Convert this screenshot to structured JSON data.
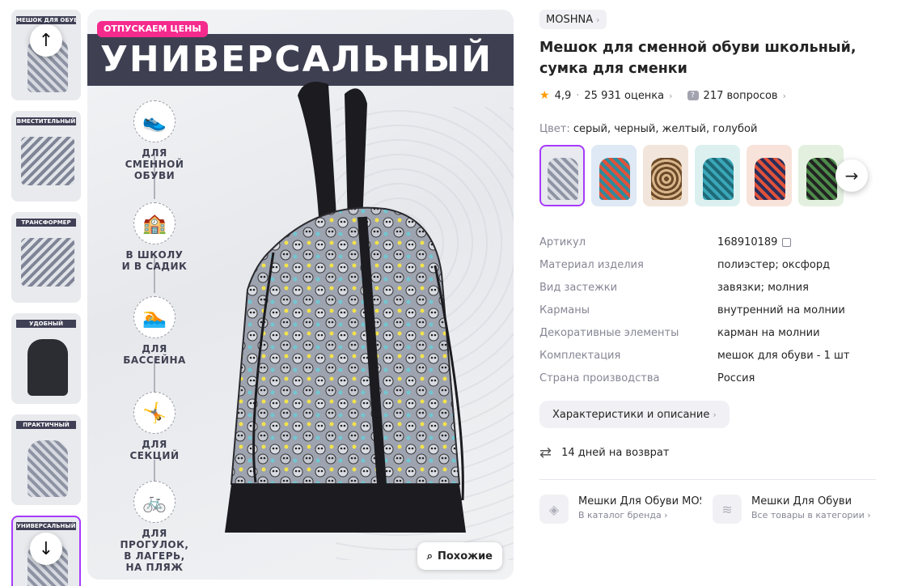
{
  "thumbnails": [
    {
      "label": "МЕШОК ДЛЯ ОБУВИ"
    },
    {
      "label": "ВМЕСТИТЕЛЬНЫЙ"
    },
    {
      "label": "ТРАНСФОРМЕР"
    },
    {
      "label": "УДОБНЫЙ"
    },
    {
      "label": "ПРАКТИЧНЫЙ"
    },
    {
      "label": "УНИВЕРСАЛЬНЫЙ"
    }
  ],
  "main_image": {
    "badge": "ОТПУСКАЕМ ЦЕНЫ",
    "banner": "УНИВЕРСАЛЬНЫЙ",
    "features": [
      {
        "icon": "shoe-icon",
        "glyph": "👟",
        "text": "ДЛЯ СМЕННОЙ ОБУВИ"
      },
      {
        "icon": "school-icon",
        "glyph": "🏫",
        "text": "В ШКОЛУ И В САДИК"
      },
      {
        "icon": "swim-icon",
        "glyph": "🏊",
        "text": "ДЛЯ БАССЕЙНА"
      },
      {
        "icon": "sport-icon",
        "glyph": "🤸",
        "text": "ДЛЯ СЕКЦИЙ"
      },
      {
        "icon": "bike-icon",
        "glyph": "🚲",
        "text": "ДЛЯ ПРОГУЛОК, В ЛАГЕРЬ, НА ПЛЯЖ"
      }
    ],
    "similar_label": "Похожие"
  },
  "product": {
    "brand": "MOSHNA",
    "title": "Мешок для сменной обуви школьный, сумка для сменки",
    "rating": "4,9",
    "reviews": "25 931 оценка",
    "questions": "217 вопросов",
    "color_label": "Цвет:",
    "color_value": "серый, черный, желтый, голубой",
    "swatch_colors": [
      "#8e94a4",
      "#2f8a9c",
      "#6b4a2a",
      "#3aa7b8",
      "#e0523a",
      "#4d8a4a"
    ],
    "specs": [
      {
        "k": "Артикул",
        "v": "168910189"
      },
      {
        "k": "Материал изделия",
        "v": "полиэстер; оксфорд"
      },
      {
        "k": "Вид застежки",
        "v": "завязки; молния"
      },
      {
        "k": "Карманы",
        "v": "внутренний на молнии"
      },
      {
        "k": "Декоративные элементы",
        "v": "карман на молнии"
      },
      {
        "k": "Комплектация",
        "v": "мешок для обуви - 1 шт"
      },
      {
        "k": "Страна производства",
        "v": "Россия"
      }
    ],
    "chars_button": "Характеристики и описание",
    "returns": "14 дней на возврат",
    "links": [
      {
        "title": "Мешки Для Обуви MOSHNA",
        "sub": "В каталог бренда"
      },
      {
        "title": "Мешки Для Обуви",
        "sub": "Все товары в категории"
      }
    ]
  },
  "colors": {
    "accent": "#a73afd",
    "badge": "#f52a8d",
    "banner": "#3e4052",
    "star": "#ff9b00"
  }
}
